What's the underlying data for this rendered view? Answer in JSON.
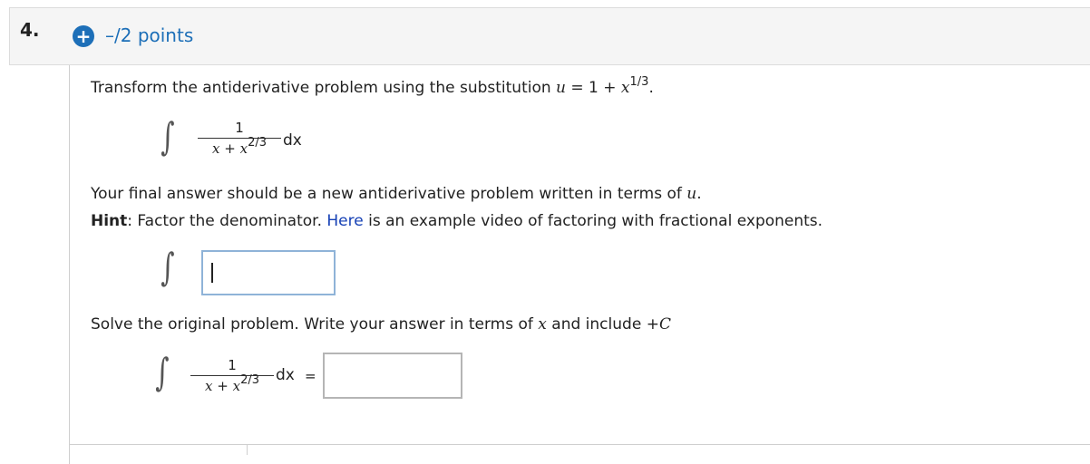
{
  "question": {
    "number": "4.",
    "badge_symbol": "+",
    "points": "–/2 points"
  },
  "instruction": {
    "text": "Transform the antiderivative problem using the substitution ",
    "u_var": "u",
    "equals": " = 1 + ",
    "x_var": "x",
    "exponent": "1/3",
    "period": "."
  },
  "integral1": {
    "symbol": "∫",
    "numerator": "1",
    "denominator_x": "x",
    "denominator_plus": " + ",
    "denominator_x2": "x",
    "denominator_exp": "2/3",
    "dx": "dx"
  },
  "final_answer_note": {
    "text": "Your final answer should be a new antiderivative problem written in terms of ",
    "var": "u",
    "period": "."
  },
  "hint": {
    "label": "Hint",
    "colon": ": Factor the denominator. ",
    "link": "Here",
    "rest": " is an example video of factoring with fractional exponents."
  },
  "answer1": {
    "symbol": "∫",
    "value": ""
  },
  "solve": {
    "text": "Solve the original problem. Write your answer in terms of ",
    "var": "x",
    "mid": " and include ",
    "plus": "+",
    "constant": "C"
  },
  "integral2": {
    "symbol": "∫",
    "numerator": "1",
    "denominator_x": "x",
    "denominator_plus": " + ",
    "denominator_x2": "x",
    "denominator_exp": "2/3",
    "dx": "dx",
    "equals": "="
  },
  "answer2": {
    "value": ""
  },
  "colors": {
    "accent": "#1d6fb8",
    "link": "#1540b5",
    "active_border": "#8fb3d8"
  },
  "icons": {
    "plus_badge": "plus-circle-icon"
  }
}
